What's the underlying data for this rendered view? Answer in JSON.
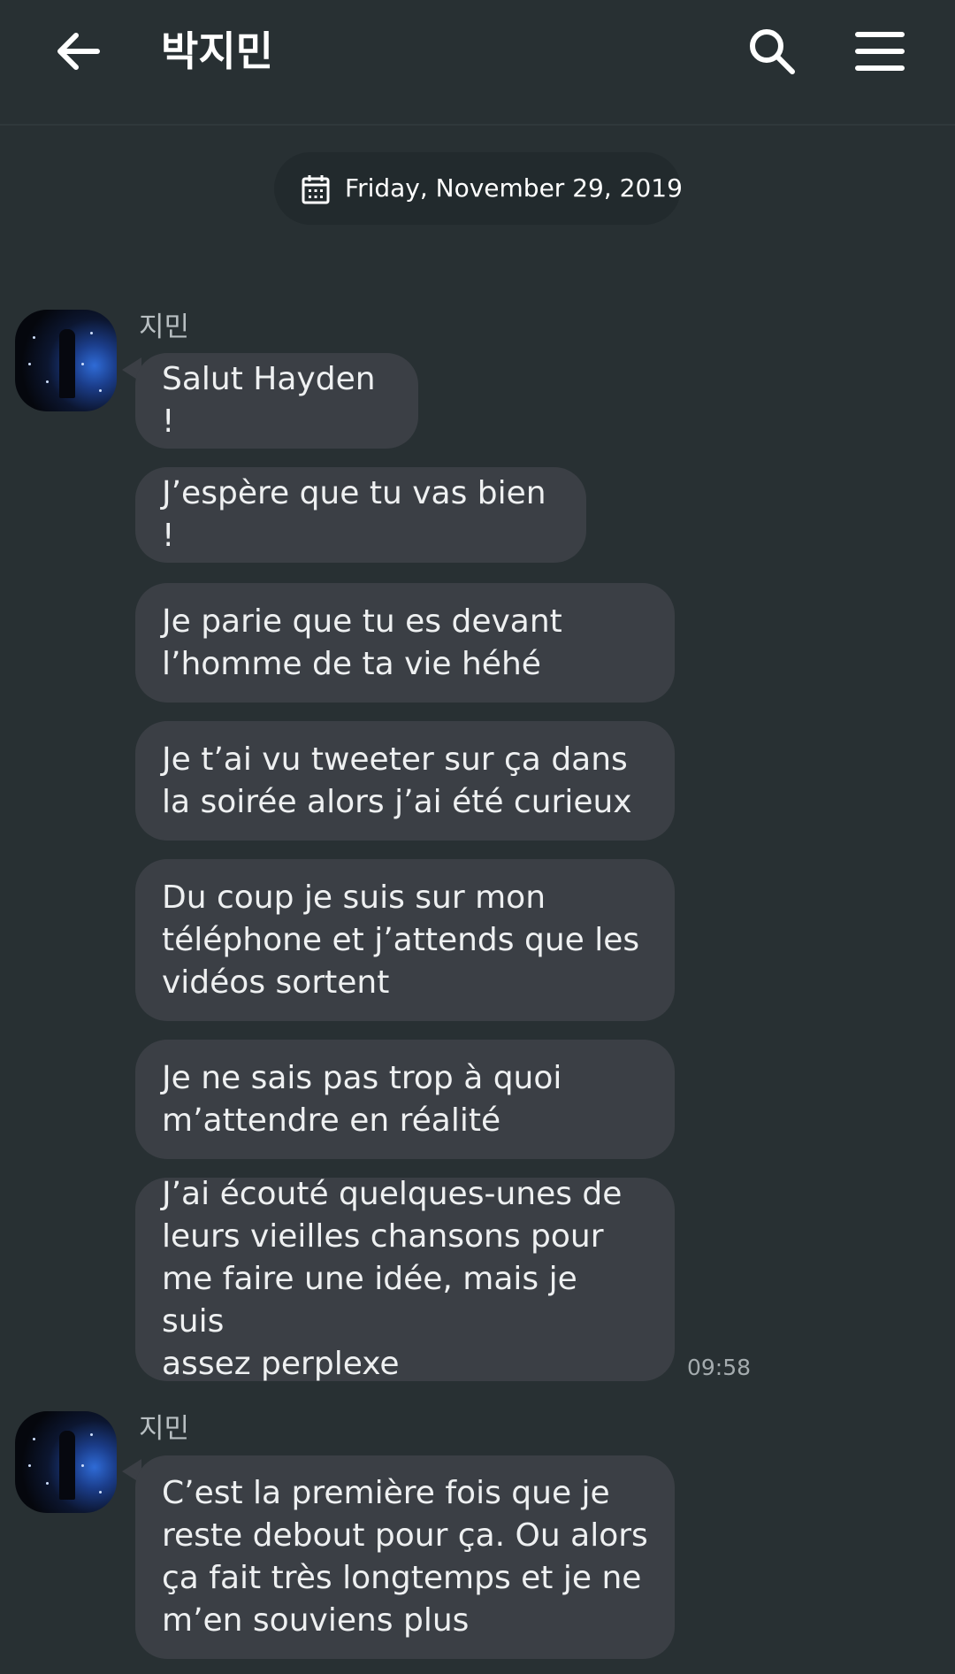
{
  "header": {
    "title": "박지민",
    "icons": {
      "back": "arrow-left-icon",
      "search": "search-icon",
      "menu": "hamburger-menu-icon"
    }
  },
  "date_divider": {
    "text": "Friday, November 29, 2019",
    "icon": "calendar-icon"
  },
  "groups": [
    {
      "sender": "지민",
      "messages": [
        "Salut Hayden !",
        "J’espère que tu vas bien !",
        "Je parie que tu es devant\nl’homme de ta vie héhé",
        "Je t’ai vu tweeter sur ça dans\nla soirée alors j’ai été curieux",
        "Du coup je suis sur mon\ntéléphone et j’attends que les\nvidéos sortent",
        "Je ne sais pas trop à quoi\nm’attendre en réalité",
        "J’ai écouté quelques-unes de\nleurs vieilles chansons pour\nme faire une idée, mais je suis\nassez perplexe"
      ],
      "time": "09:58"
    },
    {
      "sender": "지민",
      "messages": [
        "C’est la première fois que je\nreste debout pour ça. Ou alors\nça fait très longtemps et je ne\nm’en souviens plus"
      ]
    }
  ],
  "colors": {
    "background": "#283033",
    "bubble": "#3b3f45",
    "date_pill": "#222a2d",
    "text": "#eef0f1",
    "secondary_text": "#b8bfc2"
  }
}
